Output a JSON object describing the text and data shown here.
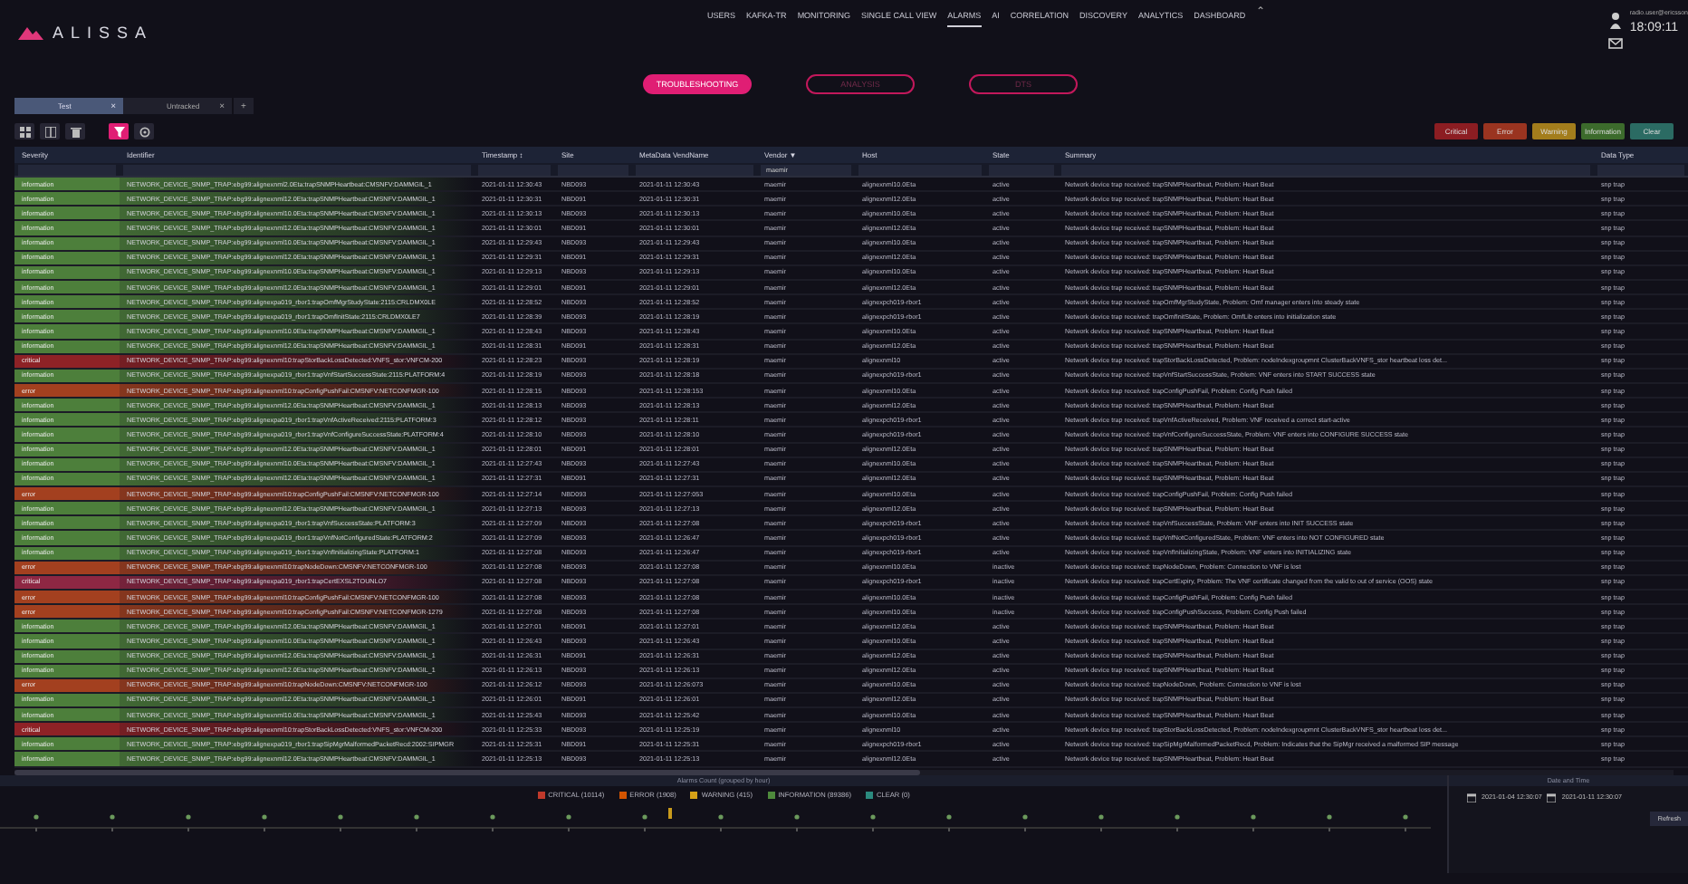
{
  "header": {
    "logo": "ALISSA",
    "nav": [
      {
        "label": "USERS",
        "selected": false
      },
      {
        "label": "KAFKA-TR",
        "selected": false
      },
      {
        "label": "MONITORING",
        "selected": false
      },
      {
        "label": "SINGLE CALL VIEW",
        "selected": false
      },
      {
        "label": "ALARMS",
        "selected": true
      },
      {
        "label": "AI",
        "selected": false
      },
      {
        "label": "CORRELATION",
        "selected": false
      },
      {
        "label": "DISCOVERY",
        "selected": false
      },
      {
        "label": "ANALYTICS",
        "selected": false
      },
      {
        "label": "DASHBOARD",
        "selected": false
      }
    ],
    "nav_toggle": "⌃",
    "user": "radio.user@ericsson",
    "time": "18:09:11"
  },
  "modes": [
    {
      "label": "TROUBLESHOOTING",
      "selected": true
    },
    {
      "label": "ANALYSIS",
      "selected": false
    },
    {
      "label": "DTS",
      "selected": false
    }
  ],
  "tabs": [
    {
      "label": "Test",
      "selected": true,
      "close": "×"
    },
    {
      "label": "Untracked",
      "selected": false,
      "close": "×"
    }
  ],
  "add_tab": "+",
  "filters": [
    {
      "label": "Critical",
      "color": "#8c1d22"
    },
    {
      "label": "Error",
      "color": "#9a3420"
    },
    {
      "label": "Warning",
      "color": "#a37d1c"
    },
    {
      "label": "Information",
      "color": "#3c6b2c"
    },
    {
      "label": "Clear",
      "color": "#2b6b63"
    }
  ],
  "table": {
    "columns": [
      {
        "label": "Severity"
      },
      {
        "label": "Identifier"
      },
      {
        "label": "Timestamp",
        "sort": "↕"
      },
      {
        "label": "Site"
      },
      {
        "label": "MetaData VendName"
      },
      {
        "label": "Vendor",
        "sort": "▼",
        "filter_value": "maemir"
      },
      {
        "label": "Host"
      },
      {
        "label": "State"
      },
      {
        "label": "Summary"
      },
      {
        "label": "Data Type"
      }
    ],
    "rows": [
      {
        "color": "#4d7f3b",
        "cells": [
          "information",
          "NETWORK_DEVICE_SNMP_TRAP:ebg99:alignexnml2.0Eta:trapSNMPHeartbeat:CMSNFV:DAMMGIL_1",
          "2021-01-11 12:30:43",
          "NBD093",
          "2021-01-11 12:30:43",
          "maemir",
          "alignexnml10.0Eta",
          "active",
          "Network device trap received: trapSNMPHeartbeat, Problem: Heart Beat",
          "snp trap"
        ]
      },
      {
        "color": "#4d7f3b",
        "cells": [
          "information",
          "NETWORK_DEVICE_SNMP_TRAP:ebg99:alignexnml12.0Eta:trapSNMPHeartbeat:CMSNFV:DAMMGIL_1",
          "2021-01-11 12:30:31",
          "NBD091",
          "2021-01-11 12:30:31",
          "maemir",
          "alignexnml12.0Eta",
          "active",
          "Network device trap received: trapSNMPHeartbeat, Problem: Heart Beat",
          "snp trap"
        ]
      },
      {
        "color": "#4d7f3b",
        "cells": [
          "information",
          "NETWORK_DEVICE_SNMP_TRAP:ebg99:alignexnml10.0Eta:trapSNMPHeartbeat:CMSNFV:DAMMGIL_1",
          "2021-01-11 12:30:13",
          "NBD093",
          "2021-01-11 12:30:13",
          "maemir",
          "alignexnml10.0Eta",
          "active",
          "Network device trap received: trapSNMPHeartbeat, Problem: Heart Beat",
          "snp trap"
        ]
      },
      {
        "color": "#4d7f3b",
        "cells": [
          "information",
          "NETWORK_DEVICE_SNMP_TRAP:ebg99:alignexnml12.0Eta:trapSNMPHeartbeat:CMSNFV:DAMMGIL_1",
          "2021-01-11 12:30:01",
          "NBD091",
          "2021-01-11 12:30:01",
          "maemir",
          "alignexnml12.0Eta",
          "active",
          "Network device trap received: trapSNMPHeartbeat, Problem: Heart Beat",
          "snp trap"
        ]
      },
      {
        "color": "#4d7f3b",
        "cells": [
          "information",
          "NETWORK_DEVICE_SNMP_TRAP:ebg99:alignexnml10.0Eta:trapSNMPHeartbeat:CMSNFV:DAMMGIL_1",
          "2021-01-11 12:29:43",
          "NBD093",
          "2021-01-11 12:29:43",
          "maemir",
          "alignexnml10.0Eta",
          "active",
          "Network device trap received: trapSNMPHeartbeat, Problem: Heart Beat",
          "snp trap"
        ]
      },
      {
        "color": "#4d7f3b",
        "cells": [
          "information",
          "NETWORK_DEVICE_SNMP_TRAP:ebg99:alignexnml12.0Eta:trapSNMPHeartbeat:CMSNFV:DAMMGIL_1",
          "2021-01-11 12:29:31",
          "NBD091",
          "2021-01-11 12:29:31",
          "maemir",
          "alignexnml12.0Eta",
          "active",
          "Network device trap received: trapSNMPHeartbeat, Problem: Heart Beat",
          "snp trap"
        ]
      },
      {
        "color": "#4d7f3b",
        "cells": [
          "information",
          "NETWORK_DEVICE_SNMP_TRAP:ebg99:alignexnml10.0Eta:trapSNMPHeartbeat:CMSNFV:DAMMGIL_1",
          "2021-01-11 12:29:13",
          "NBD093",
          "2021-01-11 12:29:13",
          "maemir",
          "alignexnml10.0Eta",
          "active",
          "Network device trap received: trapSNMPHeartbeat, Problem: Heart Beat",
          "snp trap"
        ]
      },
      {
        "color": "#4d7f3b",
        "cells": [
          "information",
          "NETWORK_DEVICE_SNMP_TRAP:ebg99:alignexnml12.0Eta:trapSNMPHeartbeat:CMSNFV:DAMMGIL_1",
          "2021-01-11 12:29:01",
          "NBD091",
          "2021-01-11 12:29:01",
          "maemir",
          "alignexnml12.0Eta",
          "active",
          "Network device trap received: trapSNMPHeartbeat, Problem: Heart Beat",
          "snp trap"
        ]
      },
      {
        "color": "#4d7f3b",
        "cells": [
          "information",
          "NETWORK_DEVICE_SNMP_TRAP:ebg99:alignexpa019_rbor1:trapOmfMgrStudyState:2115:CRLDMX0LE",
          "2021-01-11 12:28:52",
          "NBD093",
          "2021-01-11 12:28:52",
          "maemir",
          "alignexpch019-rbor1",
          "active",
          "Network device trap received: trapOmfMgrStudyState, Problem: Omf manager enters into steady state",
          "snp trap"
        ]
      },
      {
        "color": "#4d7f3b",
        "cells": [
          "information",
          "NETWORK_DEVICE_SNMP_TRAP:ebg99:alignexpa019_rbor1:trapOmfInitState:2115:CRLDMX0LE7",
          "2021-01-11 12:28:39",
          "NBD093",
          "2021-01-11 12:28:19",
          "maemir",
          "alignexpch019-rbor1",
          "active",
          "Network device trap received: trapOmfInitState, Problem: OmfLib enters into initialization state",
          "snp trap"
        ]
      },
      {
        "color": "#4d7f3b",
        "cells": [
          "information",
          "NETWORK_DEVICE_SNMP_TRAP:ebg99:alignexnml10.0Eta:trapSNMPHeartbeat:CMSNFV:DAMMGIL_1",
          "2021-01-11 12:28:43",
          "NBD093",
          "2021-01-11 12:28:43",
          "maemir",
          "alignexnml10.0Eta",
          "active",
          "Network device trap received: trapSNMPHeartbeat, Problem: Heart Beat",
          "snp trap"
        ]
      },
      {
        "color": "#4d7f3b",
        "cells": [
          "information",
          "NETWORK_DEVICE_SNMP_TRAP:ebg99:alignexnml12.0Eta:trapSNMPHeartbeat:CMSNFV:DAMMGIL_1",
          "2021-01-11 12:28:31",
          "NBD091",
          "2021-01-11 12:28:31",
          "maemir",
          "alignexnml12.0Eta",
          "active",
          "Network device trap received: trapSNMPHeartbeat, Problem: Heart Beat",
          "snp trap"
        ]
      },
      {
        "color": "#8e2226",
        "cells": [
          "critical",
          "NETWORK_DEVICE_SNMP_TRAP:ebg99:alignexnml10:trapStorBackLossDetected:VNFS_stor:VNFCM-200",
          "2021-01-11 12:28:23",
          "NBD093",
          "2021-01-11 12:28:19",
          "maemir",
          "alignexnml10",
          "active",
          "Network device trap received: trapStorBackLossDetected, Problem: nodeIndexgroupmnt ClusterBackVNFS_stor heartbeat loss det...",
          "snp trap"
        ]
      },
      {
        "color": "#4d7f3b",
        "cells": [
          "information",
          "NETWORK_DEVICE_SNMP_TRAP:ebg99:alignexpa019_rbor1:trapVnfStartSuccessState:2115:PLATFORM:4",
          "2021-01-11 12:28:19",
          "NBD093",
          "2021-01-11 12:28:18",
          "maemir",
          "alignexpch019-rbor1",
          "active",
          "Network device trap received: trapVnfStartSuccessState, Problem: VNF enters into START SUCCESS state",
          "snp trap"
        ]
      },
      {
        "color": "#a3401f",
        "cells": [
          "error",
          "NETWORK_DEVICE_SNMP_TRAP:ebg99:alignexnml10:trapConfigPushFail:CMSNFV:NETCONFMGR-100",
          "2021-01-11 12:28:15",
          "NBD093",
          "2021-01-11 12:28:153",
          "maemir",
          "alignexnml10.0Eta",
          "active",
          "Network device trap received: trapConfigPushFail, Problem: Config Push failed",
          "snp trap"
        ]
      },
      {
        "color": "#4d7f3b",
        "cells": [
          "information",
          "NETWORK_DEVICE_SNMP_TRAP:ebg99:alignexnml12.0Eta:trapSNMPHeartbeat:CMSNFV:DAMMGIL_1",
          "2021-01-11 12:28:13",
          "NBD093",
          "2021-01-11 12:28:13",
          "maemir",
          "alignexnml12.0Eta",
          "active",
          "Network device trap received: trapSNMPHeartbeat, Problem: Heart Beat",
          "snp trap"
        ]
      },
      {
        "color": "#4d7f3b",
        "cells": [
          "information",
          "NETWORK_DEVICE_SNMP_TRAP:ebg99:alignexpa019_rbor1:trapVnfActiveReceived:2115:PLATFORM:3",
          "2021-01-11 12:28:12",
          "NBD093",
          "2021-01-11 12:28:11",
          "maemir",
          "alignexpch019-rbor1",
          "active",
          "Network device trap received: trapVnfActiveReceived, Problem: VNF received a correct start-active",
          "snp trap"
        ]
      },
      {
        "color": "#4d7f3b",
        "cells": [
          "information",
          "NETWORK_DEVICE_SNMP_TRAP:ebg99:alignexpa019_rbor1:trapVnfConfigureSuccessState:PLATFORM:4",
          "2021-01-11 12:28:10",
          "NBD093",
          "2021-01-11 12:28:10",
          "maemir",
          "alignexpch019-rbor1",
          "active",
          "Network device trap received: trapVnfConfigureSuccessState, Problem: VNF enters into CONFIGURE SUCCESS state",
          "snp trap"
        ]
      },
      {
        "color": "#4d7f3b",
        "cells": [
          "information",
          "NETWORK_DEVICE_SNMP_TRAP:ebg99:alignexnml12.0Eta:trapSNMPHeartbeat:CMSNFV:DAMMGIL_1",
          "2021-01-11 12:28:01",
          "NBD091",
          "2021-01-11 12:28:01",
          "maemir",
          "alignexnml12.0Eta",
          "active",
          "Network device trap received: trapSNMPHeartbeat, Problem: Heart Beat",
          "snp trap"
        ]
      },
      {
        "color": "#4d7f3b",
        "cells": [
          "information",
          "NETWORK_DEVICE_SNMP_TRAP:ebg99:alignexnml10.0Eta:trapSNMPHeartbeat:CMSNFV:DAMMGIL_1",
          "2021-01-11 12:27:43",
          "NBD093",
          "2021-01-11 12:27:43",
          "maemir",
          "alignexnml10.0Eta",
          "active",
          "Network device trap received: trapSNMPHeartbeat, Problem: Heart Beat",
          "snp trap"
        ]
      },
      {
        "color": "#4d7f3b",
        "cells": [
          "information",
          "NETWORK_DEVICE_SNMP_TRAP:ebg99:alignexnml12.0Eta:trapSNMPHeartbeat:CMSNFV:DAMMGIL_1",
          "2021-01-11 12:27:31",
          "NBD091",
          "2021-01-11 12:27:31",
          "maemir",
          "alignexnml12.0Eta",
          "active",
          "Network device trap received: trapSNMPHeartbeat, Problem: Heart Beat",
          "snp trap"
        ]
      },
      {
        "color": "#a3401f",
        "cells": [
          "error",
          "NETWORK_DEVICE_SNMP_TRAP:ebg99:alignexnml10:trapConfigPushFail:CMSNFV:NETCONFMGR-100",
          "2021-01-11 12:27:14",
          "NBD093",
          "2021-01-11 12:27:053",
          "maemir",
          "alignexnml10.0Eta",
          "active",
          "Network device trap received: trapConfigPushFail, Problem: Config Push failed",
          "snp trap"
        ]
      },
      {
        "color": "#4d7f3b",
        "cells": [
          "information",
          "NETWORK_DEVICE_SNMP_TRAP:ebg99:alignexnml12.0Eta:trapSNMPHeartbeat:CMSNFV:DAMMGIL_1",
          "2021-01-11 12:27:13",
          "NBD093",
          "2021-01-11 12:27:13",
          "maemir",
          "alignexnml12.0Eta",
          "active",
          "Network device trap received: trapSNMPHeartbeat, Problem: Heart Beat",
          "snp trap"
        ]
      },
      {
        "color": "#4d7f3b",
        "cells": [
          "information",
          "NETWORK_DEVICE_SNMP_TRAP:ebg99:alignexpa019_rbor1:trapVnfSuccessState:PLATFORM:3",
          "2021-01-11 12:27:09",
          "NBD093",
          "2021-01-11 12:27:08",
          "maemir",
          "alignexpch019-rbor1",
          "active",
          "Network device trap received: trapVnfSuccessState, Problem: VNF enters into INIT SUCCESS state",
          "snp trap"
        ]
      },
      {
        "color": "#4d7f3b",
        "cells": [
          "information",
          "NETWORK_DEVICE_SNMP_TRAP:ebg99:alignexpa019_rbor1:trapVnfNotConfiguredState:PLATFORM:2",
          "2021-01-11 12:27:09",
          "NBD093",
          "2021-01-11 12:26:47",
          "maemir",
          "alignexpch019-rbor1",
          "active",
          "Network device trap received: trapVnfNotConfiguredState, Problem: VNF enters into NOT CONFIGURED state",
          "snp trap"
        ]
      },
      {
        "color": "#4d7f3b",
        "cells": [
          "information",
          "NETWORK_DEVICE_SNMP_TRAP:ebg99:alignexpa019_rbor1:trapVnfInitializingState:PLATFORM:1",
          "2021-01-11 12:27:08",
          "NBD093",
          "2021-01-11 12:26:47",
          "maemir",
          "alignexpch019-rbor1",
          "active",
          "Network device trap received: trapVnfInitializingState, Problem: VNF enters into INITIALIZING state",
          "snp trap"
        ]
      },
      {
        "color": "#a3401f",
        "cells": [
          "error",
          "NETWORK_DEVICE_SNMP_TRAP:ebg99:alignexnml10:trapNodeDown:CMSNFV:NETCONFMGR-100",
          "2021-01-11 12:27:08",
          "NBD093",
          "2021-01-11 12:27:08",
          "maemir",
          "alignexnml10.0Eta",
          "inactive",
          "Network device trap received: trapNodeDown, Problem: Connection to VNF is lost",
          "snp trap"
        ]
      },
      {
        "color": "#8e2743",
        "cells": [
          "critical",
          "NETWORK_DEVICE_SNMP_TRAP:ebg99:alignexpa019_rbor1:trapCertEXSL2TOUNLO7",
          "2021-01-11 12:27:08",
          "NBD093",
          "2021-01-11 12:27:08",
          "maemir",
          "alignexpch019-rbor1",
          "inactive",
          "Network device trap received: trapCertExpiry, Problem: The VNF certificate changed from the valid to out of service (OOS) state",
          "snp trap"
        ]
      },
      {
        "color": "#a3401f",
        "cells": [
          "error",
          "NETWORK_DEVICE_SNMP_TRAP:ebg99:alignexnml10:trapConfigPushFail:CMSNFV:NETCONFMGR-100",
          "2021-01-11 12:27:08",
          "NBD093",
          "2021-01-11 12:27:08",
          "maemir",
          "alignexnml10.0Eta",
          "inactive",
          "Network device trap received: trapConfigPushFail, Problem: Config Push failed",
          "snp trap"
        ]
      },
      {
        "color": "#a3401f",
        "cells": [
          "error",
          "NETWORK_DEVICE_SNMP_TRAP:ebg99:alignexnml10:trapConfigPushFail:CMSNFV:NETCONFMGR-1279",
          "2021-01-11 12:27:08",
          "NBD093",
          "2021-01-11 12:27:08",
          "maemir",
          "alignexnml10.0Eta",
          "inactive",
          "Network device trap received: trapConfigPushSuccess, Problem: Config Push failed",
          "snp trap"
        ]
      },
      {
        "color": "#4d7f3b",
        "cells": [
          "information",
          "NETWORK_DEVICE_SNMP_TRAP:ebg99:alignexnml12.0Eta:trapSNMPHeartbeat:CMSNFV:DAMMGIL_1",
          "2021-01-11 12:27:01",
          "NBD091",
          "2021-01-11 12:27:01",
          "maemir",
          "alignexnml12.0Eta",
          "active",
          "Network device trap received: trapSNMPHeartbeat, Problem: Heart Beat",
          "snp trap"
        ]
      },
      {
        "color": "#4d7f3b",
        "cells": [
          "information",
          "NETWORK_DEVICE_SNMP_TRAP:ebg99:alignexnml10.0Eta:trapSNMPHeartbeat:CMSNFV:DAMMGIL_1",
          "2021-01-11 12:26:43",
          "NBD093",
          "2021-01-11 12:26:43",
          "maemir",
          "alignexnml10.0Eta",
          "active",
          "Network device trap received: trapSNMPHeartbeat, Problem: Heart Beat",
          "snp trap"
        ]
      },
      {
        "color": "#4d7f3b",
        "cells": [
          "information",
          "NETWORK_DEVICE_SNMP_TRAP:ebg99:alignexnml12.0Eta:trapSNMPHeartbeat:CMSNFV:DAMMGIL_1",
          "2021-01-11 12:26:31",
          "NBD091",
          "2021-01-11 12:26:31",
          "maemir",
          "alignexnml12.0Eta",
          "active",
          "Network device trap received: trapSNMPHeartbeat, Problem: Heart Beat",
          "snp trap"
        ]
      },
      {
        "color": "#4d7f3b",
        "cells": [
          "information",
          "NETWORK_DEVICE_SNMP_TRAP:ebg99:alignexnml12.0Eta:trapSNMPHeartbeat:CMSNFV:DAMMGIL_1",
          "2021-01-11 12:26:13",
          "NBD093",
          "2021-01-11 12:26:13",
          "maemir",
          "alignexnml12.0Eta",
          "active",
          "Network device trap received: trapSNMPHeartbeat, Problem: Heart Beat",
          "snp trap"
        ]
      },
      {
        "color": "#a3401f",
        "cells": [
          "error",
          "NETWORK_DEVICE_SNMP_TRAP:ebg99:alignexnml10:trapNodeDown:CMSNFV:NETCONFMGR-100",
          "2021-01-11 12:26:12",
          "NBD093",
          "2021-01-11 12:26:073",
          "maemir",
          "alignexnml10.0Eta",
          "active",
          "Network device trap received: trapNodeDown, Problem: Connection to VNF is lost",
          "snp trap"
        ]
      },
      {
        "color": "#4d7f3b",
        "cells": [
          "information",
          "NETWORK_DEVICE_SNMP_TRAP:ebg99:alignexnml12.0Eta:trapSNMPHeartbeat:CMSNFV:DAMMGIL_1",
          "2021-01-11 12:26:01",
          "NBD091",
          "2021-01-11 12:26:01",
          "maemir",
          "alignexnml12.0Eta",
          "active",
          "Network device trap received: trapSNMPHeartbeat, Problem: Heart Beat",
          "snp trap"
        ]
      },
      {
        "color": "#4d7f3b",
        "cells": [
          "information",
          "NETWORK_DEVICE_SNMP_TRAP:ebg99:alignexnml10.0Eta:trapSNMPHeartbeat:CMSNFV:DAMMGIL_1",
          "2021-01-11 12:25:43",
          "NBD093",
          "2021-01-11 12:25:42",
          "maemir",
          "alignexnml10.0Eta",
          "active",
          "Network device trap received: trapSNMPHeartbeat, Problem: Heart Beat",
          "snp trap"
        ]
      },
      {
        "color": "#8e2226",
        "cells": [
          "critical",
          "NETWORK_DEVICE_SNMP_TRAP:ebg99:alignexnml10:trapStorBackLossDetected:VNFS_stor:VNFCM-200",
          "2021-01-11 12:25:33",
          "NBD093",
          "2021-01-11 12:25:19",
          "maemir",
          "alignexnml10",
          "active",
          "Network device trap received: trapStorBackLossDetected, Problem: nodeIndexgroupmnt ClusterBackVNFS_stor heartbeat loss det...",
          "snp trap"
        ]
      },
      {
        "color": "#4d7f3b",
        "cells": [
          "information",
          "NETWORK_DEVICE_SNMP_TRAP:ebg99:alignexpa019_rbor1:trapSipMgrMalformedPacketRecd:2002:SIPMGR",
          "2021-01-11 12:25:31",
          "NBD091",
          "2021-01-11 12:25:31",
          "maemir",
          "alignexpch019-rbor1",
          "active",
          "Network device trap received: trapSipMgrMalformedPacketRecd, Problem: Indicates that the SipMgr received a malformed SIP message",
          "snp trap"
        ]
      },
      {
        "color": "#4d7f3b",
        "cells": [
          "information",
          "NETWORK_DEVICE_SNMP_TRAP:ebg99:alignexnml12.0Eta:trapSNMPHeartbeat:CMSNFV:DAMMGIL_1",
          "2021-01-11 12:25:13",
          "NBD093",
          "2021-01-11 12:25:13",
          "maemir",
          "alignexnml12.0Eta",
          "active",
          "Network device trap received: trapSNMPHeartbeat, Problem: Heart Beat",
          "snp trap"
        ]
      }
    ]
  },
  "counts": {
    "title": "Alarms Count (grouped by hour)",
    "legend": [
      {
        "label": "CRITICAL (10114)",
        "color": "#c0392b"
      },
      {
        "label": "ERROR (1908)",
        "color": "#d35400"
      },
      {
        "label": "WARNING (415)",
        "color": "#d4a017"
      },
      {
        "label": "INFORMATION (89386)",
        "color": "#4e8a3c"
      },
      {
        "label": "CLEAR (0)",
        "color": "#2b8a7e"
      }
    ]
  },
  "date_range": {
    "title": "Date and Time",
    "from": "2021-01-04 12:30:07",
    "to": "2021-01-11 12:30:07",
    "apply": "Refresh"
  }
}
